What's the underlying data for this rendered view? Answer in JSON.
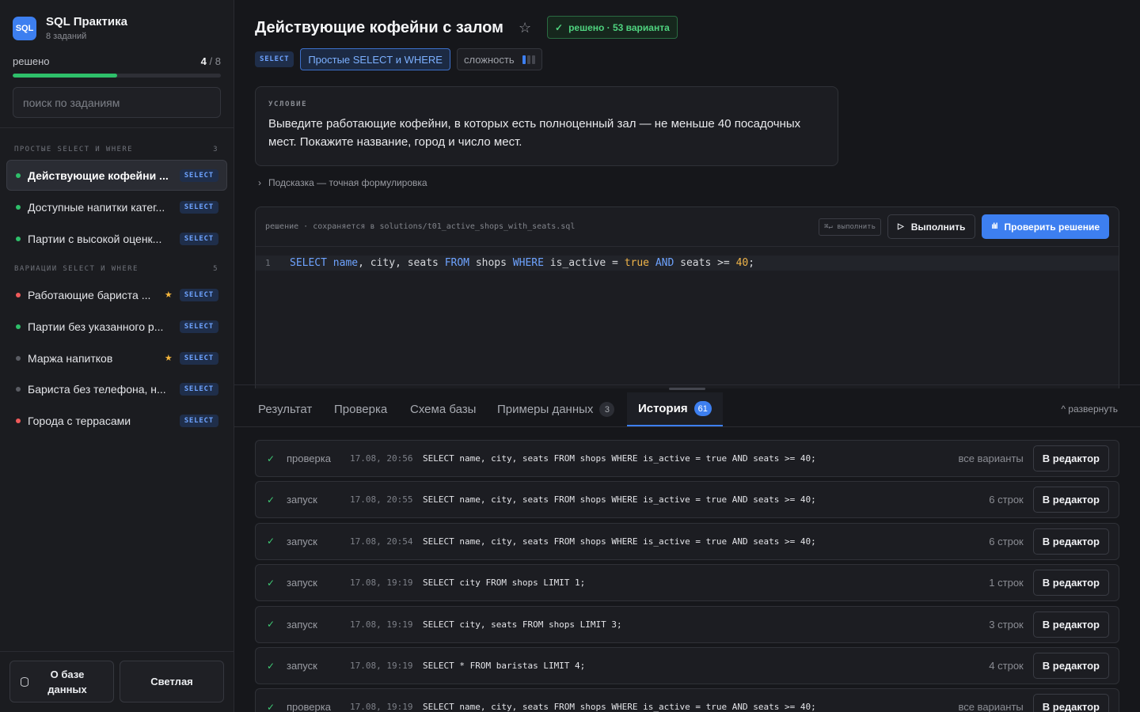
{
  "sidebar": {
    "logo_text": "SQL",
    "app_title": "SQL Практика",
    "task_count": "8 заданий",
    "progress_label": "решено",
    "progress_solved": "4",
    "progress_total": "/ 8",
    "progress_fraction": 0.5,
    "search_placeholder": "поиск по заданиям",
    "groups": [
      {
        "title": "ПРОСТЫЕ SELECT И WHERE",
        "count": "3"
      },
      {
        "title": "ВАРИАЦИИ SELECT И WHERE",
        "count": "5"
      }
    ],
    "tasks": [
      {
        "label": "Действующие кофейни ...",
        "badge": "SELECT",
        "status_color": "#2ebf6a",
        "starred": false
      },
      {
        "label": "Доступные напитки катег...",
        "badge": "SELECT",
        "status_color": "#2ebf6a",
        "starred": false
      },
      {
        "label": "Партии с высокой оценк...",
        "badge": "SELECT",
        "status_color": "#2ebf6a",
        "starred": false
      },
      {
        "label": "Работающие бариста ...",
        "badge": "SELECT",
        "status_color": "#ef5a5a",
        "starred": true
      },
      {
        "label": "Партии без указанного р...",
        "badge": "SELECT",
        "status_color": "#2ebf6a",
        "starred": false
      },
      {
        "label": "Маржа напитков",
        "badge": "SELECT",
        "status_color": "#5a5c63",
        "starred": true
      },
      {
        "label": "Бариста без телефона, н...",
        "badge": "SELECT",
        "status_color": "#5a5c63",
        "starred": false
      },
      {
        "label": "Города с террасами",
        "badge": "SELECT",
        "status_color": "#ef5a5a",
        "starred": false
      }
    ],
    "star_glyph": "★",
    "footer": {
      "about_db": "О базе данных",
      "theme": "Светлая"
    }
  },
  "task": {
    "title": "Действующие кофейни с залом",
    "star_icon": "☆",
    "solved_badge": "решено · 53 варианта",
    "check_glyph": "✓",
    "tag_select": "SELECT",
    "tag_topic": "Простые SELECT и WHERE",
    "difficulty_label": "сложность",
    "difficulty_level": 1,
    "difficulty_max": 3,
    "condition_title": "УСЛОВИЕ",
    "condition_text": "Выведите работающие кофейни, в которых есть полноценный зал — не меньше 40 посадочных мест. Покажите название, город и число мест.",
    "hint_chevron": "›",
    "hint": "Подсказка — точная формулировка"
  },
  "editor": {
    "path": "решение · сохраняется в solutions/t01_active_shops_with_seats.sql",
    "shortcut": "⌘↵ выполнить",
    "run_icon": "▷",
    "run_label": "Выполнить",
    "check_icon": "ılıl",
    "check_label": "Проверить решение",
    "line_number": "1",
    "tokens": [
      {
        "t": "SELECT",
        "c": "kw"
      },
      {
        "t": " name",
        "c": "kw"
      },
      {
        "t": ", city, seats ",
        "c": "nm"
      },
      {
        "t": "FROM",
        "c": "kw"
      },
      {
        "t": " shops ",
        "c": "nm"
      },
      {
        "t": "WHERE",
        "c": "kw"
      },
      {
        "t": " is_active = ",
        "c": "nm"
      },
      {
        "t": "true",
        "c": "bool"
      },
      {
        "t": " AND",
        "c": "kw"
      },
      {
        "t": " seats >= ",
        "c": "nm"
      },
      {
        "t": "40",
        "c": "num"
      },
      {
        "t": ";",
        "c": "nm"
      }
    ]
  },
  "tabs": [
    {
      "label": "Результат"
    },
    {
      "label": "Проверка"
    },
    {
      "label": "Схема базы"
    },
    {
      "label": "Примеры данных",
      "count": "3"
    },
    {
      "label": "История",
      "count": "61"
    }
  ],
  "expand_label": "^ развернуть",
  "history": [
    {
      "type": "проверка",
      "time": "17.08, 20:56",
      "sql": "SELECT name, city, seats FROM shops WHERE is_active = true AND seats >= 40;",
      "meta": "все варианты",
      "button": "В редактор"
    },
    {
      "type": "запуск",
      "time": "17.08, 20:55",
      "sql": "SELECT name, city, seats FROM shops WHERE is_active = true AND seats >= 40;",
      "meta": "6 строк",
      "button": "В редактор"
    },
    {
      "type": "запуск",
      "time": "17.08, 20:54",
      "sql": "SELECT name, city, seats FROM shops WHERE is_active = true AND seats >= 40;",
      "meta": "6 строк",
      "button": "В редактор"
    },
    {
      "type": "запуск",
      "time": "17.08, 19:19",
      "sql": "SELECT city FROM shops LIMIT 1;",
      "meta": "1 строк",
      "button": "В редактор"
    },
    {
      "type": "запуск",
      "time": "17.08, 19:19",
      "sql": "SELECT city, seats FROM shops LIMIT 3;",
      "meta": "3 строк",
      "button": "В редактор"
    },
    {
      "type": "запуск",
      "time": "17.08, 19:19",
      "sql": "SELECT * FROM baristas LIMIT 4;",
      "meta": "4 строк",
      "button": "В редактор"
    },
    {
      "type": "проверка",
      "time": "17.08, 19:19",
      "sql": "SELECT name, city, seats FROM shops WHERE is_active = true AND seats >= 40;",
      "meta": "все варианты",
      "button": "В редактор"
    }
  ]
}
